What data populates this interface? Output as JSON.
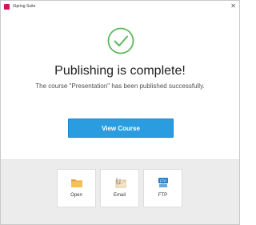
{
  "window": {
    "title": "iSpring Suite",
    "close_label": "✕"
  },
  "status": {
    "headline": "Publishing is complete!",
    "message": "The course \"Presentation\" has been published successfully.",
    "icon": "checkmark-circle-icon"
  },
  "primary_action": {
    "label": "View Course"
  },
  "actions": [
    {
      "label": "Open",
      "icon": "folder-icon"
    },
    {
      "label": "Email",
      "icon": "email-attachment-icon"
    },
    {
      "label": "FTP",
      "icon": "ftp-server-icon"
    }
  ],
  "colors": {
    "accent": "#2a9de0",
    "success": "#5cb85c",
    "app_icon": "#d4145a",
    "bottom_panel": "#ececec"
  }
}
